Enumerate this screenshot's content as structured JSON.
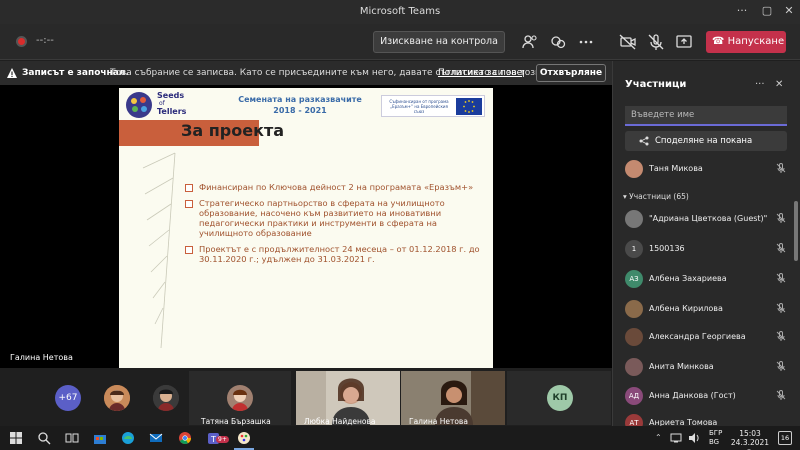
{
  "window": {
    "title": "Microsoft Teams"
  },
  "toolbar": {
    "timer": "--:--",
    "take_control": "Изискване на контрола",
    "hangup": "Напускане"
  },
  "banner": {
    "bold": "Записът е започнал.",
    "message": "Това събрание се записва. Като се присъедините към него, давате съгласието си за този запис.",
    "policy": "Политика за поверителност",
    "reject": "Отхвърляне"
  },
  "slide": {
    "logo_top": "Seeds",
    "logo_of": "of",
    "logo_bottom": "Tellers",
    "header_line1": "Семената на разказвачите",
    "header_line2": "2018 - 2021",
    "eu_text": "Съфинансиран от програма „Еразъм+“ на Европейския съюз",
    "title": "За проекта",
    "bullets": [
      "Финансиран по Ключова дейност 2 на програмата «Еразъм+»",
      "Стратегическо партньорство  в сферата на училищното образование,  насочено към развитието на иновативни педагогически практики и инструменти в сферата на училищното образование",
      "Проектът е с продължителност 24 месеца – от 01.12.2018 г. до 30.11.2020 г.; удължен до 31.03.2021 г."
    ]
  },
  "stage_name": "Галина Нетова",
  "strip": {
    "more": "+67",
    "tile3_name": "Татяна Бързашка",
    "tile4_name": "Любка Найденова",
    "tile5_name": "Галина Нетова",
    "tile6_initials": "КП"
  },
  "sidebar": {
    "title": "Участници",
    "search_placeholder": "Въведете име",
    "share": "Споделяне на покана",
    "presenter": "Таня Микова",
    "count": "Участници (65)",
    "people": [
      {
        "name": "\"Адриана Цветкова (Guest)\" ...",
        "initials": "",
        "color": "#777777"
      },
      {
        "name": "1500136",
        "initials": "1",
        "color": "#4a4a4a"
      },
      {
        "name": "Албена Захариева",
        "initials": "АЗ",
        "color": "#3f8a6b"
      },
      {
        "name": "Албена Кирилова",
        "initials": "",
        "color": "#8a6a4a"
      },
      {
        "name": "Александра Георгиева",
        "initials": "",
        "color": "#6a4a3a"
      },
      {
        "name": "Анита Минкова",
        "initials": "",
        "color": "#7a5a5a"
      },
      {
        "name": "Анна Данкова (Гост)",
        "initials": "АД",
        "color": "#8a4a7a"
      },
      {
        "name": "Анриета Томова",
        "initials": "АТ",
        "color": "#9a3a3a"
      }
    ]
  },
  "taskbar": {
    "lang1": "БГР",
    "lang2": "BG",
    "time": "15:03",
    "date": "24.3.2021 г.",
    "badge": "9+",
    "notif": "16"
  }
}
